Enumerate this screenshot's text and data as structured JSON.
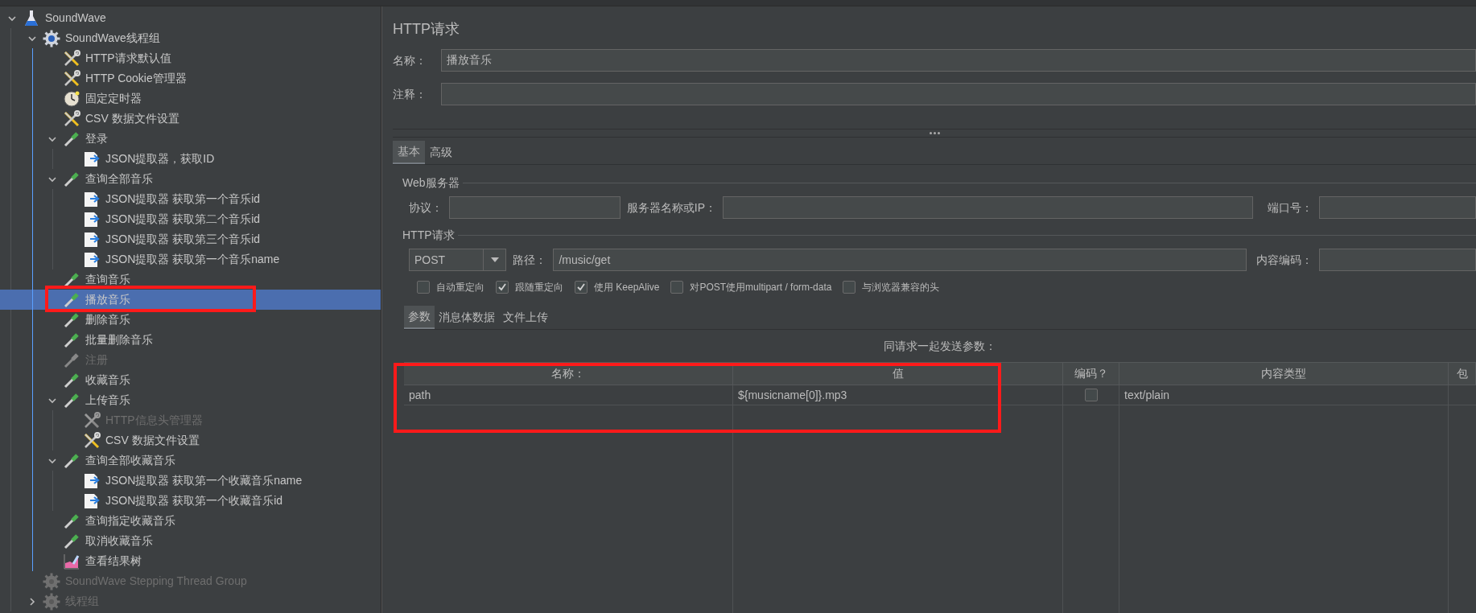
{
  "tree": [
    {
      "label": "SoundWave",
      "kind": "testplan",
      "enabled": true,
      "selected": false,
      "expanded": true,
      "children": [
        {
          "label": "SoundWave线程组",
          "kind": "threadgroup",
          "enabled": true,
          "selected": false,
          "expanded": true,
          "children": [
            {
              "label": "HTTP请求默认值",
              "kind": "config",
              "enabled": true,
              "selected": false
            },
            {
              "label": "HTTP Cookie管理器",
              "kind": "config",
              "enabled": true,
              "selected": false
            },
            {
              "label": "固定定时器",
              "kind": "timer",
              "enabled": true,
              "selected": false
            },
            {
              "label": "CSV 数据文件设置",
              "kind": "config",
              "enabled": true,
              "selected": false
            },
            {
              "label": "登录",
              "kind": "sampler",
              "enabled": true,
              "selected": false,
              "expanded": true,
              "children": [
                {
                  "label": "JSON提取器，获取ID",
                  "kind": "extractor",
                  "enabled": true,
                  "selected": false
                }
              ]
            },
            {
              "label": "查询全部音乐",
              "kind": "sampler",
              "enabled": true,
              "selected": false,
              "expanded": true,
              "children": [
                {
                  "label": "JSON提取器 获取第一个音乐id",
                  "kind": "extractor",
                  "enabled": true,
                  "selected": false
                },
                {
                  "label": "JSON提取器 获取第二个音乐id",
                  "kind": "extractor",
                  "enabled": true,
                  "selected": false
                },
                {
                  "label": "JSON提取器 获取第三个音乐id",
                  "kind": "extractor",
                  "enabled": true,
                  "selected": false
                },
                {
                  "label": "JSON提取器 获取第一个音乐name",
                  "kind": "extractor",
                  "enabled": true,
                  "selected": false
                }
              ]
            },
            {
              "label": "查询音乐",
              "kind": "sampler",
              "enabled": true,
              "selected": false
            },
            {
              "label": "播放音乐",
              "kind": "sampler",
              "enabled": true,
              "selected": true
            },
            {
              "label": "删除音乐",
              "kind": "sampler",
              "enabled": true,
              "selected": false
            },
            {
              "label": "批量删除音乐",
              "kind": "sampler",
              "enabled": true,
              "selected": false
            },
            {
              "label": "注册",
              "kind": "sampler",
              "enabled": false,
              "selected": false
            },
            {
              "label": "收藏音乐",
              "kind": "sampler",
              "enabled": true,
              "selected": false
            },
            {
              "label": "上传音乐",
              "kind": "sampler",
              "enabled": true,
              "selected": false,
              "expanded": true,
              "children": [
                {
                  "label": "HTTP信息头管理器",
                  "kind": "config",
                  "enabled": false,
                  "selected": false
                },
                {
                  "label": "CSV 数据文件设置",
                  "kind": "config",
                  "enabled": true,
                  "selected": false
                }
              ]
            },
            {
              "label": "查询全部收藏音乐",
              "kind": "sampler",
              "enabled": true,
              "selected": false,
              "expanded": true,
              "children": [
                {
                  "label": "JSON提取器 获取第一个收藏音乐name",
                  "kind": "extractor",
                  "enabled": true,
                  "selected": false
                },
                {
                  "label": "JSON提取器 获取第一个收藏音乐id",
                  "kind": "extractor",
                  "enabled": true,
                  "selected": false
                }
              ]
            },
            {
              "label": "查询指定收藏音乐",
              "kind": "sampler",
              "enabled": true,
              "selected": false
            },
            {
              "label": "取消收藏音乐",
              "kind": "sampler",
              "enabled": true,
              "selected": false
            },
            {
              "label": "查看结果树",
              "kind": "listener",
              "enabled": true,
              "selected": false
            }
          ]
        },
        {
          "label": "SoundWave Stepping Thread Group",
          "kind": "threadgroup",
          "enabled": false,
          "selected": false
        },
        {
          "label": "线程组",
          "kind": "threadgroup",
          "enabled": false,
          "selected": false,
          "expanded": false
        }
      ]
    }
  ],
  "panel": {
    "title": "HTTP请求",
    "name": {
      "label": "名称：",
      "value": "播放音乐"
    },
    "comment": {
      "label": "注释："
    },
    "tabs": [
      {
        "label": "基本",
        "selected": true
      },
      {
        "label": "高级",
        "selected": false
      }
    ],
    "web_server": {
      "legend": "Web服务器",
      "protocol_label": "协议：",
      "server_label": "服务器名称或IP：",
      "port_label": "端口号："
    },
    "http_request": {
      "legend": "HTTP请求",
      "method": "POST",
      "path_label": "路径：",
      "path": "/music/get",
      "encoding_label": "内容编码：",
      "options": [
        {
          "label": "自动重定向",
          "checked": false
        },
        {
          "label": "跟随重定向",
          "checked": true
        },
        {
          "label": "使用 KeepAlive",
          "checked": true
        },
        {
          "label": "对POST使用multipart / form-data",
          "checked": false
        },
        {
          "label": "与浏览器兼容的头",
          "checked": false
        }
      ]
    },
    "sub_tabs": [
      {
        "label": "参数",
        "selected": true
      },
      {
        "label": "消息体数据",
        "selected": false
      },
      {
        "label": "文件上传",
        "selected": false
      }
    ],
    "params_caption": "同请求一起发送参数：",
    "table": {
      "columns": [
        "名称：",
        "值",
        "编码？",
        "内容类型",
        "包"
      ],
      "rows": [
        {
          "name": "path",
          "value": "${musicname[0]}.mp3",
          "encode": false,
          "content_type": "text/plain"
        }
      ]
    }
  }
}
